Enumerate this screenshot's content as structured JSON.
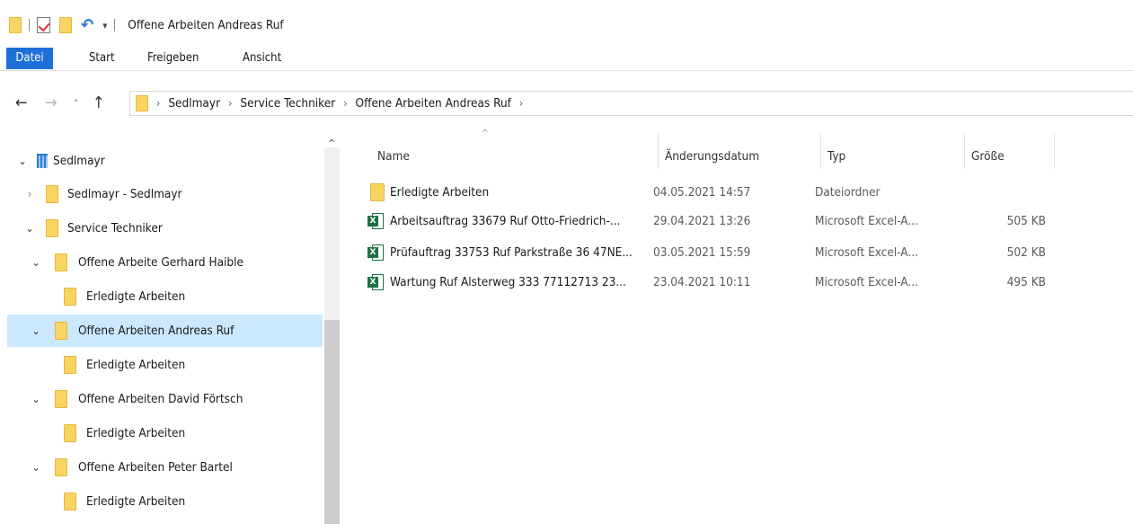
{
  "window": {
    "title": "Offene Arbeiten Andreas Ruf"
  },
  "ribbon": {
    "tabs": [
      "Datei",
      "Start",
      "Freigeben",
      "Ansicht"
    ]
  },
  "address": {
    "crumbs": [
      "Sedlmayr",
      "Service Techniker",
      "Offene Arbeiten Andreas Ruf"
    ]
  },
  "navpane": {
    "items": [
      {
        "label": "Sedlmayr",
        "icon": "building-icon",
        "expanded": true
      },
      {
        "label": "Sedlmayr - Sedlmayr",
        "icon": "folder-icon",
        "expanded": false
      },
      {
        "label": "Service Techniker",
        "icon": "folder-icon",
        "expanded": true
      },
      {
        "label": "Offene Arbeite Gerhard Haible",
        "icon": "folder-icon",
        "expanded": true
      },
      {
        "label": "Erledigte Arbeiten",
        "icon": "folder-icon"
      },
      {
        "label": "Offene Arbeiten Andreas Ruf",
        "icon": "folder-icon",
        "expanded": true,
        "selected": true
      },
      {
        "label": "Erledigte Arbeiten",
        "icon": "folder-icon"
      },
      {
        "label": "Offene Arbeiten David Förtsch",
        "icon": "folder-icon",
        "expanded": true
      },
      {
        "label": "Erledigte Arbeiten",
        "icon": "folder-icon"
      },
      {
        "label": "Offene Arbeiten Peter Bartel",
        "icon": "folder-icon",
        "expanded": true
      },
      {
        "label": "Erledigte Arbeiten",
        "icon": "folder-icon"
      }
    ]
  },
  "columns": {
    "name": "Name",
    "date": "Änderungsdatum",
    "type": "Typ",
    "size": "Größe"
  },
  "files": [
    {
      "name": "Erledigte Arbeiten",
      "date": "04.05.2021 14:57",
      "type": "Dateiordner",
      "size": "",
      "icon": "folder-icon"
    },
    {
      "name": "Arbeitsauftrag  33679 Ruf Otto-Friedrich-...",
      "date": "29.04.2021 13:26",
      "type": "Microsoft Excel-A...",
      "size": "505 KB",
      "icon": "excel-icon"
    },
    {
      "name": "Prüfauftrag 33753 Ruf Parkstraße 36 47NE...",
      "date": "03.05.2021 15:59",
      "type": "Microsoft Excel-A...",
      "size": "502 KB",
      "icon": "excel-icon"
    },
    {
      "name": "Wartung Ruf  Alsterweg 333 77112713  23...",
      "date": "23.04.2021 10:11",
      "type": "Microsoft Excel-A...",
      "size": "495 KB",
      "icon": "excel-icon"
    }
  ],
  "colors": {
    "accent": "#1e6fd9",
    "selection": "#cce8ff",
    "folder": "#f8d462",
    "excel": "#1e7145"
  }
}
